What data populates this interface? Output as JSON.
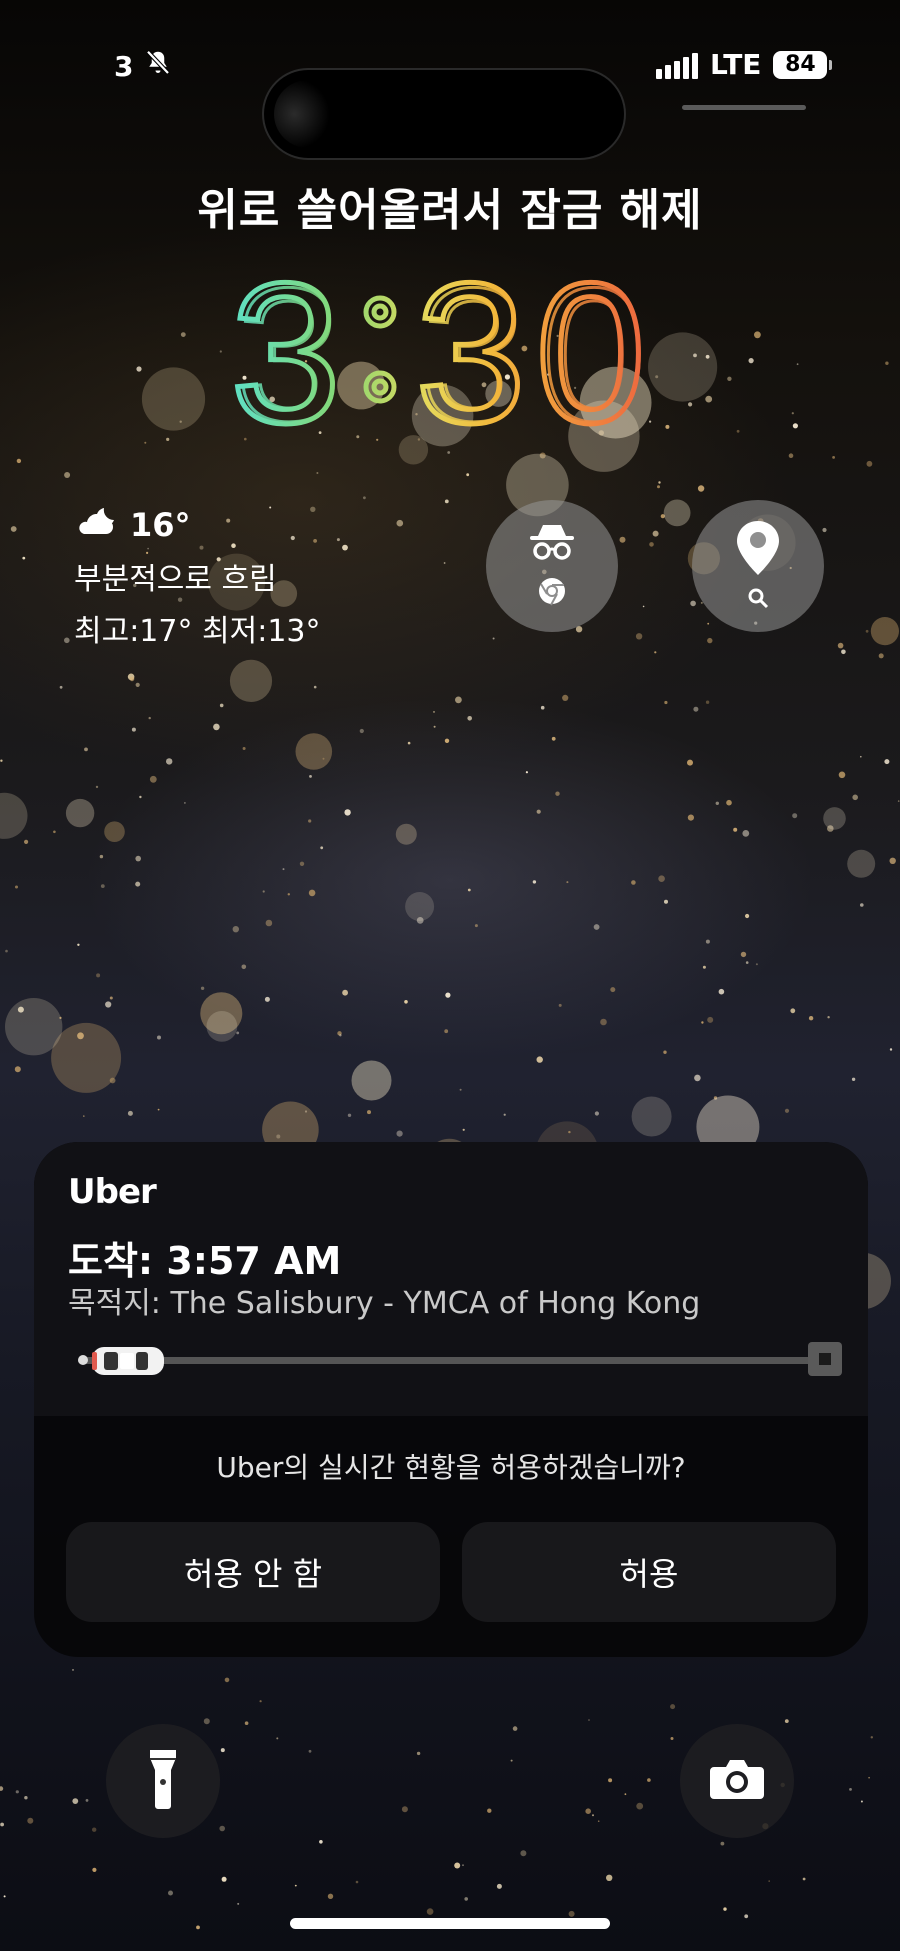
{
  "status_bar": {
    "notification_count": "3",
    "silent_icon": "bell-slash-icon",
    "network": "LTE",
    "battery": "84"
  },
  "lock_screen": {
    "unlock_hint": "위로 쓸어올려서 잠금 해제",
    "time_hour": "3",
    "time_minute_tens": "3",
    "time_minute_ones": "0"
  },
  "weather": {
    "icon": "partly-cloudy-night-icon",
    "temperature": "16°",
    "condition": "부분적으로 흐림",
    "high_low": "최고:17° 최저:13°"
  },
  "widgets": [
    {
      "name": "chrome-incognito",
      "icon": "incognito-icon"
    },
    {
      "name": "maps-search",
      "icon": "map-pin-search-icon"
    }
  ],
  "live_activity": {
    "app": "Uber",
    "arrival": "도착: 3:57 AM",
    "destination": "목적지: The Salisbury - YMCA of Hong Kong",
    "trip_progress": 0.05,
    "prompt": "Uber의 실시간 현황을 허용하겠습니까?",
    "deny_label": "허용 안 함",
    "allow_label": "허용"
  },
  "bottom": {
    "left_icon": "flashlight-icon",
    "right_icon": "camera-icon"
  },
  "colors": {
    "clock_gradient": [
      "#5ee0c6",
      "#7fd97a",
      "#d6e26a",
      "#f0c040",
      "#f1a23c",
      "#ef6a3f"
    ],
    "card_bg": "#0a0a0c",
    "button_bg": "#18181b"
  }
}
